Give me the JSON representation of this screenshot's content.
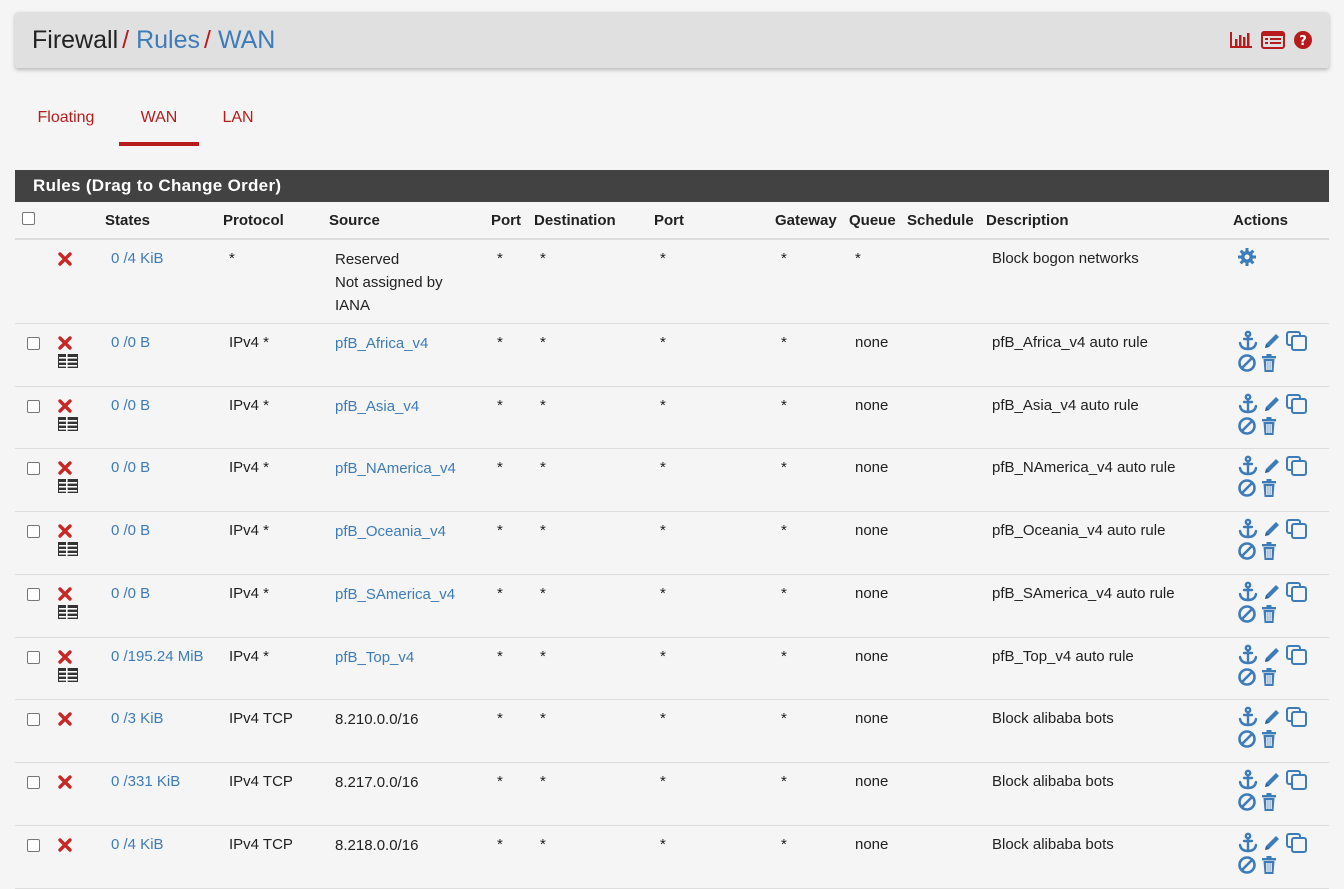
{
  "breadcrumb": {
    "first": "Firewall",
    "sep": "/",
    "second": "Rules",
    "third": "WAN"
  },
  "header_icons": [
    "bar-chart-icon",
    "list-icon",
    "help-icon"
  ],
  "tabs": [
    {
      "label": "Floating",
      "active": false
    },
    {
      "label": "WAN",
      "active": true
    },
    {
      "label": "LAN",
      "active": false
    }
  ],
  "panel": {
    "title": "Rules (Drag to Change Order)"
  },
  "table": {
    "headers": {
      "states": "States",
      "protocol": "Protocol",
      "source": "Source",
      "port": "Port",
      "destination": "Destination",
      "port2": "Port",
      "gateway": "Gateway",
      "queue": "Queue",
      "schedule": "Schedule",
      "description": "Description",
      "actions": "Actions"
    },
    "rows": [
      {
        "states": "0 /4 KiB",
        "protocol": "*",
        "source": "Reserved\nNot assigned by\nIANA",
        "source_link": false,
        "port": "*",
        "destination": "*",
        "dport": "*",
        "gateway": "*",
        "queue": "*",
        "description": "Block bogon networks",
        "checkbox": false,
        "list_icon": false,
        "actions": "gear"
      },
      {
        "states": "0 /0 B",
        "protocol": "IPv4 *",
        "source": "pfB_Africa_v4",
        "source_link": true,
        "port": "*",
        "destination": "*",
        "dport": "*",
        "gateway": "*",
        "queue": "none",
        "description": "pfB_Africa_v4 auto rule",
        "checkbox": true,
        "list_icon": true,
        "actions": "full"
      },
      {
        "states": "0 /0 B",
        "protocol": "IPv4 *",
        "source": "pfB_Asia_v4",
        "source_link": true,
        "port": "*",
        "destination": "*",
        "dport": "*",
        "gateway": "*",
        "queue": "none",
        "description": "pfB_Asia_v4 auto rule",
        "checkbox": true,
        "list_icon": true,
        "actions": "full"
      },
      {
        "states": "0 /0 B",
        "protocol": "IPv4 *",
        "source": "pfB_NAmerica_v4",
        "source_link": true,
        "port": "*",
        "destination": "*",
        "dport": "*",
        "gateway": "*",
        "queue": "none",
        "description": "pfB_NAmerica_v4 auto rule",
        "checkbox": true,
        "list_icon": true,
        "actions": "full"
      },
      {
        "states": "0 /0 B",
        "protocol": "IPv4 *",
        "source": "pfB_Oceania_v4",
        "source_link": true,
        "port": "*",
        "destination": "*",
        "dport": "*",
        "gateway": "*",
        "queue": "none",
        "description": "pfB_Oceania_v4 auto rule",
        "checkbox": true,
        "list_icon": true,
        "actions": "full"
      },
      {
        "states": "0 /0 B",
        "protocol": "IPv4 *",
        "source": "pfB_SAmerica_v4",
        "source_link": true,
        "port": "*",
        "destination": "*",
        "dport": "*",
        "gateway": "*",
        "queue": "none",
        "description": "pfB_SAmerica_v4 auto rule",
        "checkbox": true,
        "list_icon": true,
        "actions": "full"
      },
      {
        "states": "0 /195.24 MiB",
        "protocol": "IPv4 *",
        "source": "pfB_Top_v4",
        "source_link": true,
        "port": "*",
        "destination": "*",
        "dport": "*",
        "gateway": "*",
        "queue": "none",
        "description": "pfB_Top_v4 auto rule",
        "checkbox": true,
        "list_icon": true,
        "actions": "full"
      },
      {
        "states": "0 /3 KiB",
        "protocol": "IPv4 TCP",
        "source": "8.210.0.0/16",
        "source_link": false,
        "port": "*",
        "destination": "*",
        "dport": "*",
        "gateway": "*",
        "queue": "none",
        "description": "Block alibaba bots",
        "checkbox": true,
        "list_icon": false,
        "actions": "full"
      },
      {
        "states": "0 /331 KiB",
        "protocol": "IPv4 TCP",
        "source": "8.217.0.0/16",
        "source_link": false,
        "port": "*",
        "destination": "*",
        "dport": "*",
        "gateway": "*",
        "queue": "none",
        "description": "Block alibaba bots",
        "checkbox": true,
        "list_icon": false,
        "actions": "full"
      },
      {
        "states": "0 /4 KiB",
        "protocol": "IPv4 TCP",
        "source": "8.218.0.0/16",
        "source_link": false,
        "port": "*",
        "destination": "*",
        "dport": "*",
        "gateway": "*",
        "queue": "none",
        "description": "Block alibaba bots",
        "checkbox": true,
        "list_icon": false,
        "actions": "full"
      }
    ]
  },
  "colors": {
    "accent_red": "#b71c1c",
    "link_blue": "#3d7cb8",
    "panel_heading": "#424242"
  }
}
